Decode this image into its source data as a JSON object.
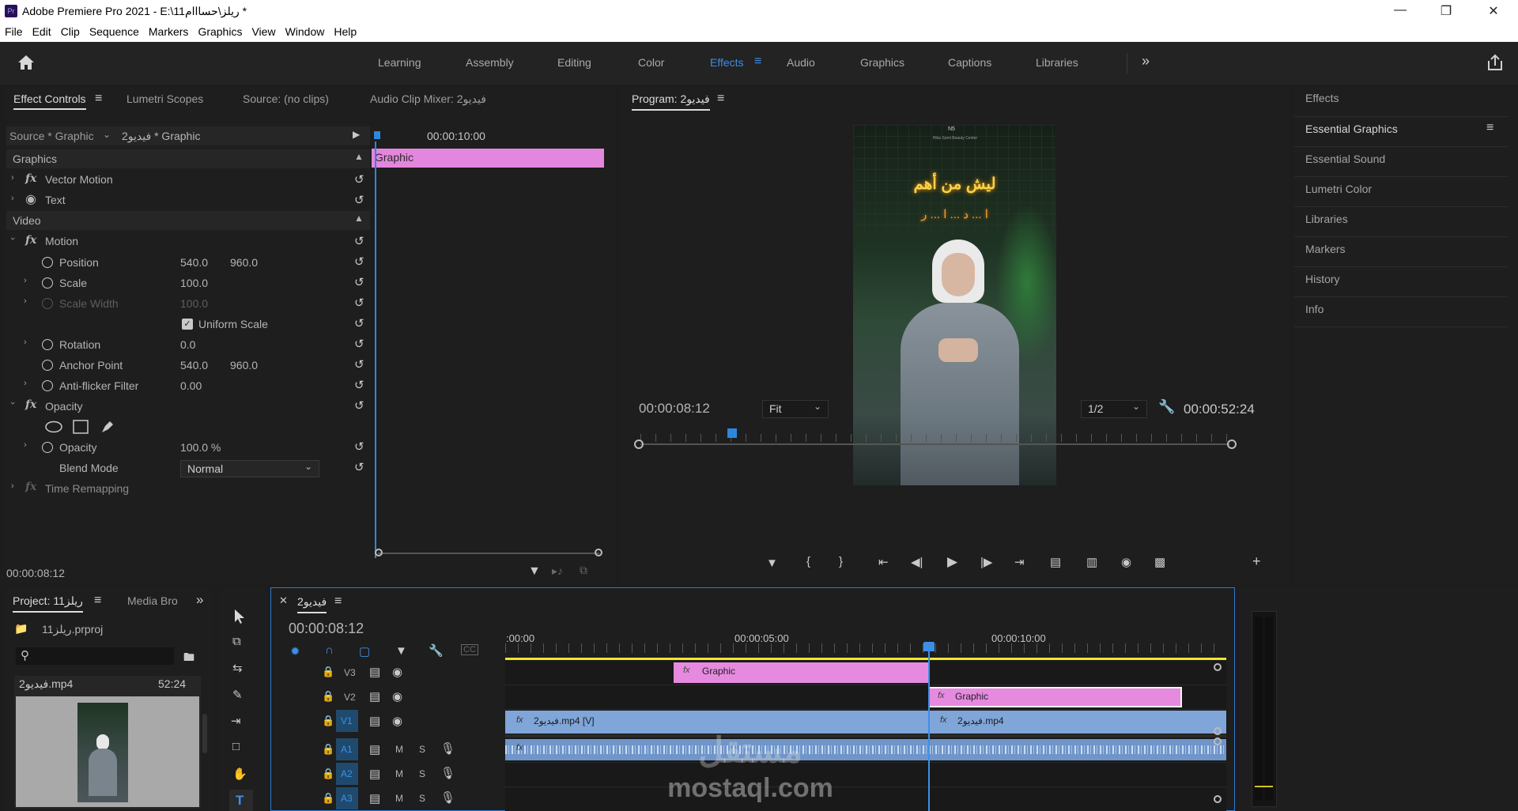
{
  "window": {
    "title": "Adobe Premiere Pro 2021 - E:\\11ريلز\\حسااام *",
    "app_icon": "Pr",
    "controls": [
      "minimize-icon",
      "restore-icon",
      "close-icon"
    ]
  },
  "menu": [
    "File",
    "Edit",
    "Clip",
    "Sequence",
    "Markers",
    "Graphics",
    "View",
    "Window",
    "Help"
  ],
  "workspaces": [
    "Learning",
    "Assembly",
    "Editing",
    "Color",
    "Effects",
    "Audio",
    "Graphics",
    "Captions",
    "Libraries"
  ],
  "active_workspace": "Effects",
  "effect_controls": {
    "tabs": [
      "Effect Controls",
      "Lumetri Scopes",
      "Source: (no clips)",
      "Audio Clip Mixer: فيديو2"
    ],
    "source_label": "Source * Graphic",
    "clip_label": "فيديو2 * Graphic",
    "ruler_time": "00:00:10:00",
    "clip_bar_label": "Graphic",
    "section_graphics": "Graphics",
    "vector_motion": "Vector Motion",
    "text": "Text",
    "section_video": "Video",
    "motion": "Motion",
    "position": {
      "label": "Position",
      "x": "540.0",
      "y": "960.0"
    },
    "scale": {
      "label": "Scale",
      "value": "100.0"
    },
    "scale_width": {
      "label": "Scale Width",
      "value": "100.0"
    },
    "uniform_scale": "Uniform Scale",
    "rotation": {
      "label": "Rotation",
      "value": "0.0"
    },
    "anchor_point": {
      "label": "Anchor Point",
      "x": "540.0",
      "y": "960.0"
    },
    "anti_flicker": {
      "label": "Anti-flicker Filter",
      "value": "0.00"
    },
    "opacity_section": "Opacity",
    "opacity": {
      "label": "Opacity",
      "value": "100.0 %"
    },
    "blend_mode": {
      "label": "Blend Mode",
      "value": "Normal"
    },
    "time_remapping": "Time Remapping",
    "current_time": "00:00:08:12"
  },
  "program_monitor": {
    "title": "Program: فيديو2",
    "timecode": "00:00:08:12",
    "fit": "Fit",
    "resolution": "1/2",
    "duration": "00:00:52:24",
    "frame": {
      "badge": "N5",
      "caption_small": "Hiba Sami Beauty Center",
      "headline": "ليش من أهم",
      "sub": "ا ... د ... ا ... ر"
    }
  },
  "right_panel": [
    "Effects",
    "Essential Graphics",
    "Essential Sound",
    "Lumetri Color",
    "Libraries",
    "Markers",
    "History",
    "Info"
  ],
  "project": {
    "tabs": [
      "Project: ريلز11",
      "Media Bro"
    ],
    "file": "ريلز11.prproj",
    "item_name": "فيديو2.mp4",
    "item_duration": "52:24"
  },
  "timeline": {
    "sequence": "فيديو2",
    "timecode": "00:00:08:12",
    "ruler": [
      ":00:00",
      "00:00:05:00",
      "00:00:10:00"
    ],
    "video_tracks": [
      "V3",
      "V2",
      "V1"
    ],
    "audio_tracks": [
      "A1",
      "A2",
      "A3"
    ],
    "clips": {
      "v3": "Graphic",
      "v2": "Graphic",
      "v1a": "فيديو2.mp4 [V]",
      "v1b": "فيديو2.mp4"
    },
    "track_buttons": {
      "mute": "M",
      "solo": "S"
    }
  },
  "watermark": {
    "brand": "مستقل",
    "domain": "mostaql.com"
  },
  "colors": {
    "accent": "#3d8ce5",
    "graphic_clip": "#e68ae0",
    "video_clip": "#7fa5d9",
    "audio_clip": "#6f95c9",
    "work_area": "#f0e52f"
  }
}
